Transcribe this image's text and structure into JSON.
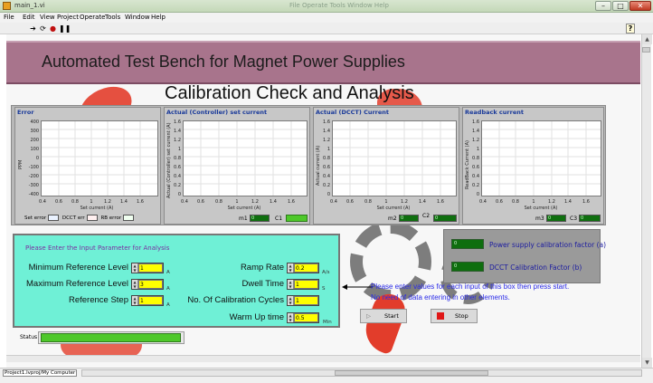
{
  "window": {
    "title": "main_1.vi",
    "ghost_menu": "File   Operate   Tools   Window   Help"
  },
  "menu": [
    "File",
    "Edit",
    "View",
    "Project",
    "Operate",
    "Tools",
    "Window",
    "Help"
  ],
  "banner_title": "Automated Test Bench for Magnet Power Supplies",
  "subtitle": "Calibration Check and Analysis",
  "charts": [
    {
      "title": "Error",
      "ylabel": "PPM",
      "yticks": [
        "400",
        "300",
        "200",
        "100",
        "0",
        "-100",
        "-200",
        "-300",
        "-400"
      ],
      "xticks": [
        "0.4",
        "0.6",
        "0.8",
        "1",
        "1.2",
        "1.4",
        "1.6"
      ],
      "xlabel": "Set current (A)"
    },
    {
      "title": "Actual (Controller) set current",
      "ylabel": "Actual (Controller) set current (A)",
      "yticks": [
        "1.6",
        "1.4",
        "1.2",
        "1",
        "0.8",
        "0.6",
        "0.4",
        "0.2",
        "0"
      ],
      "xticks": [
        "0.4",
        "0.6",
        "0.8",
        "1",
        "1.2",
        "1.4",
        "1.6"
      ],
      "xlabel": "Set current (A)"
    },
    {
      "title": "Actual (DCCT) Current",
      "ylabel": "Actual current (A)",
      "yticks": [
        "1.6",
        "1.4",
        "1.2",
        "1",
        "0.8",
        "0.6",
        "0.4",
        "0.2",
        "0"
      ],
      "xticks": [
        "0.4",
        "0.6",
        "0.8",
        "1",
        "1.2",
        "1.4",
        "1.6"
      ],
      "xlabel": "Set current (A)"
    },
    {
      "title": "Readback current",
      "ylabel": "ReadBack Current (A)",
      "yticks": [
        "1.6",
        "1.4",
        "1.2",
        "1",
        "0.8",
        "0.6",
        "0.4",
        "0.2",
        "0"
      ],
      "xticks": [
        "0.4",
        "0.6",
        "0.8",
        "1",
        "1.2",
        "1.4",
        "1.6"
      ],
      "xlabel": "Set current (A)"
    }
  ],
  "legend": {
    "set_error": "Set error",
    "dcct_err": "DCCT err",
    "rb_error": "RB error"
  },
  "fit": {
    "m1": "m1",
    "c1": "C1",
    "m2": "m2",
    "c2": "C2",
    "m3": "m3",
    "c3": "C3",
    "m1_val": "0",
    "c1_val": "0",
    "m2_val": "0",
    "c2_val": "0",
    "m3_val": "0",
    "c3_val": "0"
  },
  "inputs": {
    "header": "Please Enter the Input Parameter for Analysis",
    "min_ref_label": "Minimum Reference Level",
    "min_ref_value": "1",
    "min_ref_unit": "A",
    "max_ref_label": "Maximum Reference Level",
    "max_ref_value": "3",
    "max_ref_unit": "A",
    "ref_step_label": "Reference Step",
    "ref_step_value": "1",
    "ref_step_unit": "A",
    "ramp_label": "Ramp Rate",
    "ramp_value": "0.2",
    "ramp_unit": "A/s",
    "dwell_label": "Dwell Time",
    "dwell_value": "1",
    "dwell_unit": "S",
    "cycles_label": "No. Of Calibration Cycles",
    "cycles_value": "1",
    "warmup_label": "Warm Up time",
    "warmup_value": "0.5",
    "warmup_unit": "Min"
  },
  "factors": {
    "ps_label": "Power supply calibration factor (a)",
    "ps_value": "0",
    "dcct_label": "DCCT Calibration Factor (b)",
    "dcct_value": "0"
  },
  "note": {
    "line1": "Please enter values for each input of this box then press start.",
    "line2": "No need of data entering in other elements."
  },
  "buttons": {
    "start": "Start",
    "stop": "Stop"
  },
  "status": {
    "label": "Status",
    "progress": 1.0
  },
  "footer": {
    "path": "Project1.lvproj/My Computer"
  },
  "colors": {
    "banner": "#a8748c",
    "input_box": "#6ff0d6",
    "chart_title": "#1a3a9a",
    "note": "#2a2ae8",
    "indicator": "#4ec82a"
  }
}
